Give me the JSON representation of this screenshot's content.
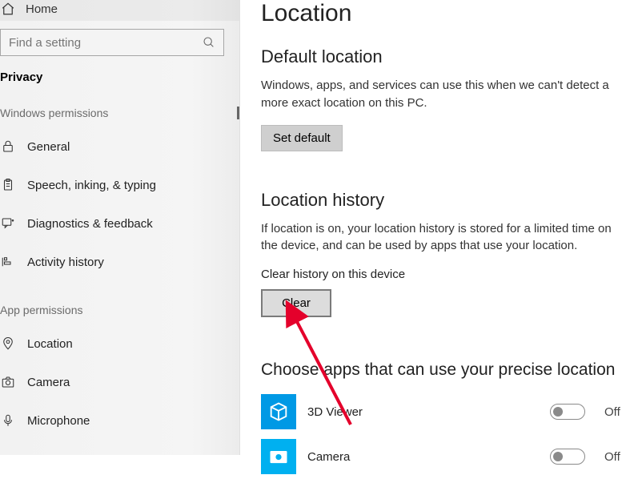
{
  "sidebar": {
    "home": "Home",
    "search_placeholder": "Find a setting",
    "privacy_header": "Privacy",
    "cat_windows": "Windows permissions",
    "cat_app": "App permissions",
    "items_win": [
      {
        "label": "General"
      },
      {
        "label": "Speech, inking, & typing"
      },
      {
        "label": "Diagnostics & feedback"
      },
      {
        "label": "Activity history"
      }
    ],
    "items_app": [
      {
        "label": "Location"
      },
      {
        "label": "Camera"
      },
      {
        "label": "Microphone"
      }
    ]
  },
  "main": {
    "title": "Location",
    "default_loc": {
      "heading": "Default location",
      "desc": "Windows, apps, and services can use this when we can't detect a more exact location on this PC.",
      "button": "Set default"
    },
    "history": {
      "heading": "Location history",
      "desc": "If location is on, your location history is stored for a limited time on the device, and can be used by apps that use your location.",
      "clear_label": "Clear history on this device",
      "clear_button": "Clear"
    },
    "choose_apps": {
      "heading": "Choose apps that can use your precise location",
      "apps": [
        {
          "name": "3D Viewer",
          "state": "Off"
        },
        {
          "name": "Camera",
          "state": "Off"
        }
      ]
    }
  }
}
